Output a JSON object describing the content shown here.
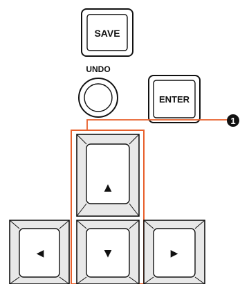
{
  "buttons": {
    "save": "SAVE",
    "undo": "UNDO",
    "enter": "ENTER"
  },
  "arrows": {
    "up": "▲",
    "down": "▼",
    "left": "◀",
    "right": "▶"
  },
  "callout": {
    "number": "1",
    "color": "#e8602c"
  },
  "colors": {
    "key_face": "#ffffff",
    "key_bevel": "#e8e8e8",
    "key_outline": "#111111",
    "callout_badge": "#111111"
  }
}
